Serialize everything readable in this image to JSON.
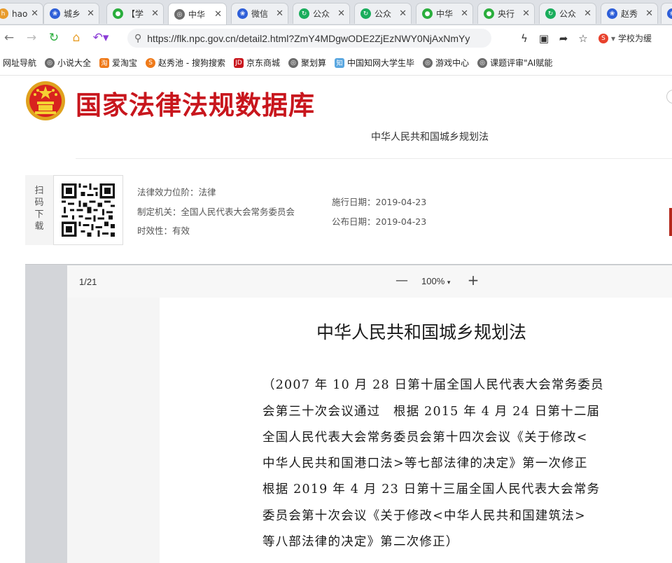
{
  "browser": {
    "tabs": [
      {
        "label": "hao",
        "icon": "hao-icon",
        "color": "#e89b2c"
      },
      {
        "label": "城乡",
        "icon": "baidu-paw-icon",
        "color": "#2f5fd8"
      },
      {
        "label": "【学",
        "icon": "wechat-icon",
        "color": "#2aae3d"
      },
      {
        "label": "中华",
        "icon": "globe-icon",
        "color": "#6b6b6b"
      },
      {
        "label": "微信",
        "icon": "baidu-paw-icon",
        "color": "#2f5fd8"
      },
      {
        "label": "公众",
        "icon": "refresh-green-icon",
        "color": "#1aad5c"
      },
      {
        "label": "公众",
        "icon": "refresh-green-icon",
        "color": "#1aad5c"
      },
      {
        "label": "中华",
        "icon": "wechat-icon",
        "color": "#2aae3d"
      },
      {
        "label": "央行",
        "icon": "wechat-icon",
        "color": "#2aae3d"
      },
      {
        "label": "公众",
        "icon": "refresh-green-icon",
        "color": "#1aad5c"
      },
      {
        "label": "赵秀",
        "icon": "baidu-paw-icon",
        "color": "#2f5fd8"
      }
    ],
    "address": {
      "url": "https://flk.npc.gov.cn/detail2.html?ZmY4MDgwODE2ZjEzNWY0NjAxNmYy"
    },
    "promo_text": "学校为缓",
    "bookmarks": [
      {
        "label": "网址导航",
        "icon": "none"
      },
      {
        "label": "小说大全",
        "icon": "globe-icon",
        "color": "#6b6b6b"
      },
      {
        "label": "爱淘宝",
        "icon": "taobao-icon",
        "color": "#ef7a1a"
      },
      {
        "label": "赵秀池 - 搜狗搜索",
        "icon": "sogou-icon",
        "color": "#ef7a1a"
      },
      {
        "label": "京东商城",
        "icon": "jd-icon",
        "color": "#c8161d"
      },
      {
        "label": "聚划算",
        "icon": "globe-icon",
        "color": "#6b6b6b"
      },
      {
        "label": "中国知网大学生毕",
        "icon": "cnki-icon",
        "color": "#5aa7e0"
      },
      {
        "label": "游戏中心",
        "icon": "globe-icon",
        "color": "#6b6b6b"
      },
      {
        "label": "课题评审\"AI赋能",
        "icon": "globe-icon",
        "color": "#6b6b6b"
      }
    ]
  },
  "site": {
    "title": "国家法律法规数据库",
    "title_color": "#c8161d",
    "law_name": "中华人民共和国城乡规划法"
  },
  "info": {
    "scan_label": "扫码下载",
    "effect_level": "法律效力位阶：法律",
    "authority": "制定机关：全国人民代表大会常务委员会",
    "validity": "时效性：有效",
    "effective_date": "施行日期：2019-04-23",
    "publish_date": "公布日期：2019-04-23"
  },
  "viewer": {
    "page_indicator": "1/21",
    "zoom_minus": "—",
    "zoom": "100%",
    "zoom_plus": "+"
  },
  "document": {
    "title": "中华人民共和国城乡规划法",
    "lines": [
      "（2007 年 10 月 28 日第十届全国人民代表大会常务委员",
      "会第三十次会议通过　根据 2015 年 4 月 24 日第十二届",
      "全国人民代表大会常务委员会第十四次会议《关于修改<",
      "中华人民共和国港口法>等七部法律的决定》第一次修正",
      "根据 2019 年 4 月 23 日第十三届全国人民代表大会常务",
      "委员会第十次会议《关于修改<中华人民共和国建筑法>",
      "等八部法律的决定》第二次修正）"
    ]
  }
}
